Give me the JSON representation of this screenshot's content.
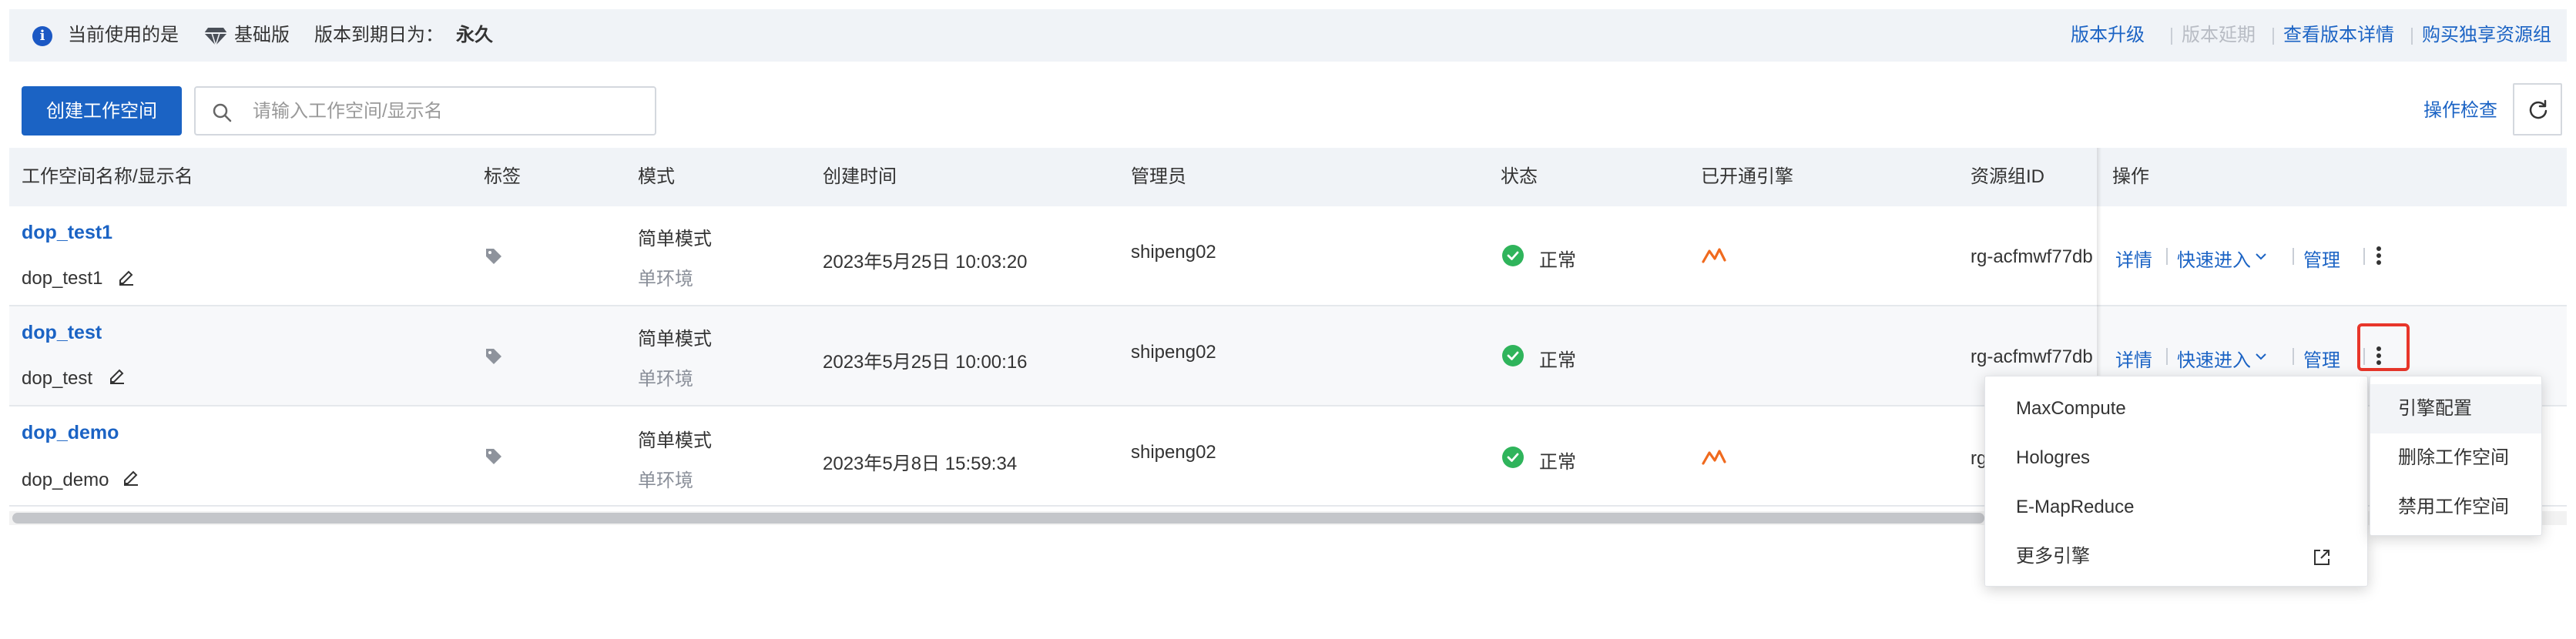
{
  "banner": {
    "prefix": "当前使用的是",
    "edition": "基础版",
    "expire_label": "版本到期日为：",
    "expire_value": "永久",
    "links": {
      "upgrade": "版本升级",
      "extend": "版本延期",
      "details": "查看版本详情",
      "buy": "购买独享资源组"
    }
  },
  "toolbar": {
    "create_label": "创建工作空间",
    "search_placeholder": "请输入工作空间/显示名",
    "op_check_label": "操作检查"
  },
  "table": {
    "headers": {
      "name": "工作空间名称/显示名",
      "tags": "标签",
      "mode": "模式",
      "created": "创建时间",
      "admin": "管理员",
      "status": "状态",
      "engines": "已开通引擎",
      "resource_group": "资源组ID",
      "actions": "操作"
    },
    "rows": [
      {
        "name": "dop_test1",
        "display": "dop_test1",
        "mode": "简单模式",
        "env": "单环境",
        "created": "2023年5月25日 10:03:20",
        "admin": "shipeng02",
        "status": "正常",
        "resource_group": "rg-acfmwf77db"
      },
      {
        "name": "dop_test",
        "display": "dop_test",
        "mode": "简单模式",
        "env": "单环境",
        "created": "2023年5月25日 10:00:16",
        "admin": "shipeng02",
        "status": "正常",
        "resource_group": "rg-acfmwf77db"
      },
      {
        "name": "dop_demo",
        "display": "dop_demo",
        "mode": "简单模式",
        "env": "单环境",
        "created": "2023年5月8日 15:59:34",
        "admin": "shipeng02",
        "status": "正常",
        "resource_group": "rg"
      }
    ],
    "actions": {
      "details": "详情",
      "quick_enter": "快速进入",
      "manage": "管理"
    }
  },
  "engine_menu": {
    "items": [
      "MaxCompute",
      "Hologres",
      "E-MapReduce"
    ],
    "more": "更多引擎"
  },
  "more_menu": {
    "items": [
      "引擎配置",
      "删除工作空间",
      "禁用工作空间"
    ]
  },
  "colors": {
    "primary": "#1b63c4",
    "success": "#2fb45b",
    "engine_orange": "#f06a1e",
    "highlight": "#e8362a"
  }
}
